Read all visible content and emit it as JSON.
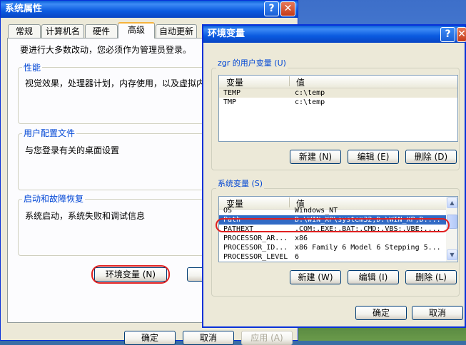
{
  "sys_props": {
    "title": "系统属性",
    "tabs": [
      "常规",
      "计算机名",
      "硬件",
      "高级",
      "自动更新"
    ],
    "admin_note": "要进行大多数改动，您必须作为管理员登录。",
    "performance": {
      "legend": "性能",
      "desc": "视觉效果，处理器计划，内存使用，以及虚拟内"
    },
    "user_profiles": {
      "legend": "用户配置文件",
      "desc": "与您登录有关的桌面设置"
    },
    "startup_recovery": {
      "legend": "启动和故障恢复",
      "desc": "系统启动，系统失败和调试信息"
    },
    "env_vars_button": "环境变量 (N)",
    "ok": "确定",
    "cancel": "取消",
    "apply": "应用 (A)"
  },
  "env_dialog": {
    "title": "环境变量",
    "user_vars": {
      "legend": "zgr 的用户变量 (U)",
      "col_var": "变量",
      "col_val": "值",
      "rows": [
        {
          "name": "TEMP",
          "value": "c:\\temp"
        },
        {
          "name": "TMP",
          "value": "c:\\temp"
        }
      ],
      "new": "新建 (N)",
      "edit": "编辑 (E)",
      "delete": "删除 (D)"
    },
    "sys_vars": {
      "legend": "系统变量 (S)",
      "col_var": "变量",
      "col_val": "值",
      "rows": [
        {
          "name": "OS",
          "value": "Windows_NT"
        },
        {
          "name": "Path",
          "value": "D:\\WIN_XP\\system32;D:\\WIN_XP;D:..."
        },
        {
          "name": "PATHEXT",
          "value": ".COM;.EXE;.BAT;.CMD;.VBS;.VBE;...."
        },
        {
          "name": "PROCESSOR_AR...",
          "value": "x86"
        },
        {
          "name": "PROCESSOR_ID...",
          "value": "x86 Family 6 Model 6 Stepping 5..."
        },
        {
          "name": "PROCESSOR_LEVEL",
          "value": "6"
        }
      ],
      "new": "新建 (W)",
      "edit": "编辑 (I)",
      "delete": "删除 (L)"
    },
    "ok": "确定",
    "cancel": "取消"
  }
}
